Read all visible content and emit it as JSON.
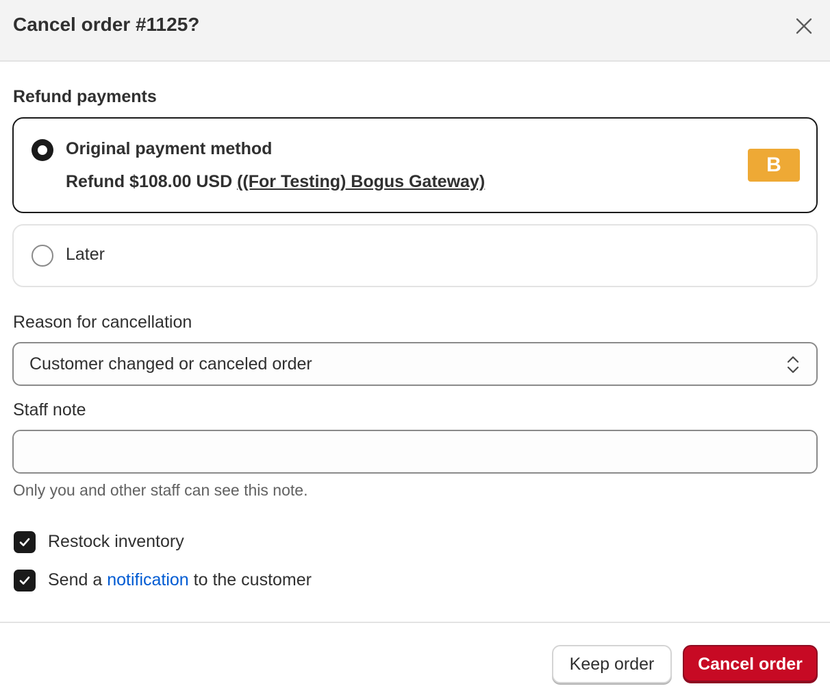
{
  "dialog": {
    "title": "Cancel order #1125?",
    "close_icon": "close-icon"
  },
  "refund": {
    "section_label": "Refund payments",
    "options": [
      {
        "title": "Original payment method",
        "desc_prefix": "Refund $108.00 USD ",
        "gateway_link": "((For Testing) Bogus Gateway)",
        "badge": "B",
        "selected": true
      },
      {
        "title": "Later",
        "selected": false
      }
    ]
  },
  "reason": {
    "label": "Reason for cancellation",
    "selected_value": "Customer changed or canceled order"
  },
  "staff_note": {
    "label": "Staff note",
    "value": "",
    "help": "Only you and other staff can see this note."
  },
  "checkboxes": {
    "restock": {
      "label": "Restock inventory",
      "checked": true
    },
    "notify": {
      "prefix": "Send a ",
      "link": "notification",
      "suffix": " to the customer",
      "checked": true
    }
  },
  "footer": {
    "keep_label": "Keep order",
    "cancel_label": "Cancel order"
  },
  "colors": {
    "primary_danger": "#c70a24",
    "link": "#005bd3",
    "badge": "#eea935"
  }
}
